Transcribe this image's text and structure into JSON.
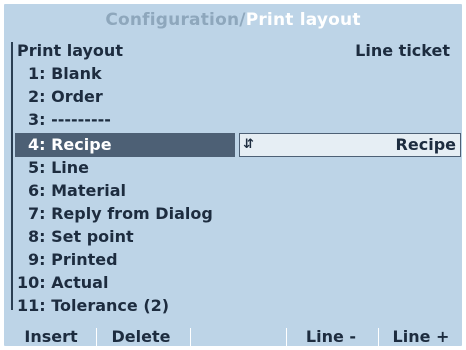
{
  "header": {
    "crumb": "Configuration",
    "separator": "/",
    "current": "Print layout"
  },
  "list_header": {
    "left": "Print layout",
    "right": "Line ticket"
  },
  "rows": [
    {
      "label": "1: Blank"
    },
    {
      "label": "2: Order"
    },
    {
      "label": "3: ---------"
    },
    {
      "label": "4: Recipe",
      "value": "Recipe",
      "selected": true
    },
    {
      "label": "5: Line"
    },
    {
      "label": "6: Material"
    },
    {
      "label": "7: Reply from Dialog"
    },
    {
      "label": "8: Set point"
    },
    {
      "label": "9: Printed"
    },
    {
      "label": "10: Actual"
    },
    {
      "label": "11: Tolerance (2)"
    }
  ],
  "softkeys": [
    "Insert",
    "Delete",
    "",
    "Line -",
    "Line +"
  ],
  "icons": {
    "selector": "up-down-arrows-icon"
  },
  "colors": {
    "background": "#bdd4e7",
    "selection": "#4d6075",
    "text": "#1d2c3f"
  }
}
